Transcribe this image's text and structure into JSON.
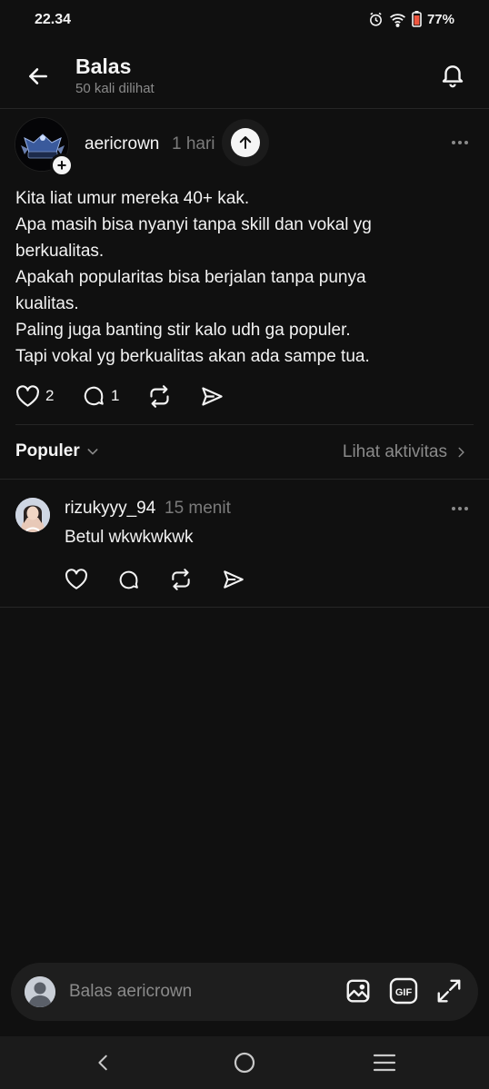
{
  "status_bar": {
    "time": "22.34",
    "battery": "77%",
    "icons": [
      "alarm-icon",
      "wifi-icon",
      "battery-icon"
    ]
  },
  "header": {
    "title": "Balas",
    "subtitle": "50 kali dilihat",
    "back_icon": "arrow-left-icon",
    "bell_icon": "bell-icon"
  },
  "post": {
    "username": "aericrown",
    "time": "1 hari",
    "lines": [
      "Kita liat umur mereka 40+ kak.",
      "Apa masih bisa nyanyi tanpa skill dan vokal yg",
      "berkualitas.",
      "Apakah popularitas bisa berjalan tanpa punya",
      "kualitas.",
      "Paling juga banting stir kalo udh ga populer.",
      "Tapi vokal yg berkualitas akan ada sampe tua."
    ],
    "likes": "2",
    "replies": "1",
    "avatar_plus": "+"
  },
  "sort": {
    "label": "Populer",
    "activity_link": "Lihat aktivitas"
  },
  "reply": {
    "username": "rizukyyy_94",
    "time": "15 menit",
    "text": "Betul wkwkwkwk"
  },
  "composer": {
    "placeholder": "Balas aericrown",
    "gif_label": "GIF",
    "icons": [
      "image-icon",
      "gif-icon",
      "expand-icon"
    ]
  },
  "colors": {
    "background": "#101010",
    "text": "#f3f3f3",
    "muted": "#8a8a8a",
    "divider": "#262626",
    "composer": "#1e1e1e"
  }
}
